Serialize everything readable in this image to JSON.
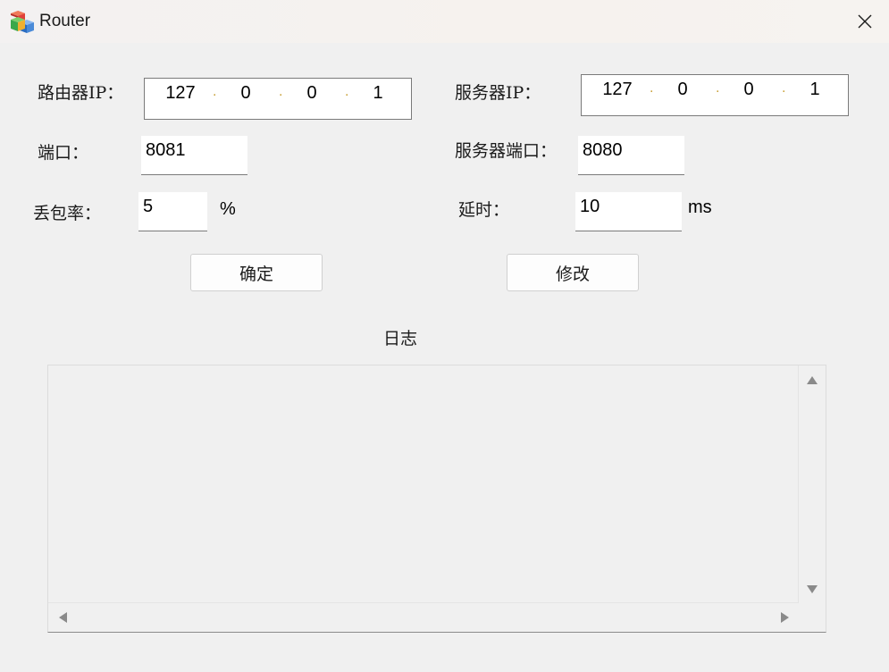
{
  "window": {
    "title": "Router",
    "icon": "mfc-app-icon",
    "close_icon": "close-icon"
  },
  "router_ip": {
    "label": "路由器IP：",
    "octets": [
      "127",
      "0",
      "0",
      "1"
    ]
  },
  "server_ip": {
    "label": "服务器IP：",
    "octets": [
      "127",
      "0",
      "0",
      "1"
    ]
  },
  "port": {
    "label": "端口：",
    "value": "8081"
  },
  "server_port": {
    "label": "服务器端口：",
    "value": "8080"
  },
  "loss_rate": {
    "label": "丢包率：",
    "value": "5",
    "unit": "%"
  },
  "delay": {
    "label": "延时：",
    "value": "10",
    "unit": "ms"
  },
  "buttons": {
    "confirm": "确定",
    "modify": "修改"
  },
  "log": {
    "title": "日志",
    "content": ""
  },
  "colors": {
    "background": "#f0f0f0",
    "field": "#ffffff",
    "ip_dot": "#c9a23a"
  }
}
